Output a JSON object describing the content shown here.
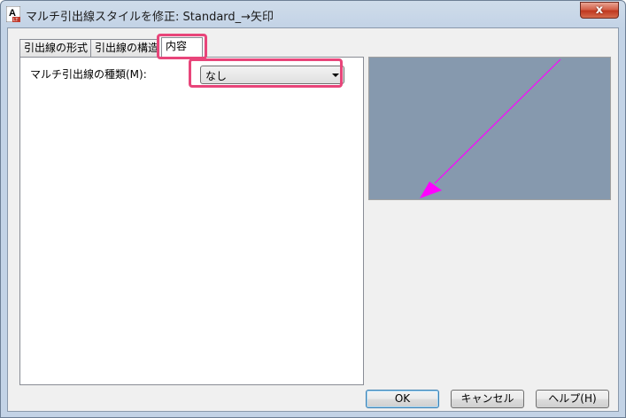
{
  "window": {
    "title": "マルチ引出線スタイルを修正: Standard_→矢印",
    "icon_letters": "A",
    "icon_badge": "LT",
    "close_symbol": "x"
  },
  "tabs": [
    {
      "label": "引出線の形式",
      "active": false
    },
    {
      "label": "引出線の構造",
      "active": false
    },
    {
      "label": "内容",
      "active": true
    }
  ],
  "content": {
    "multileader_type_label": "マルチ引出線の種類(M):",
    "multileader_type_value": "なし"
  },
  "preview": {
    "background": "#8699ae",
    "leader_color": "#ff00ff"
  },
  "buttons": {
    "ok": "OK",
    "cancel": "キャンセル",
    "help": "ヘルプ(H)"
  },
  "highlight_color": "#e8457a"
}
